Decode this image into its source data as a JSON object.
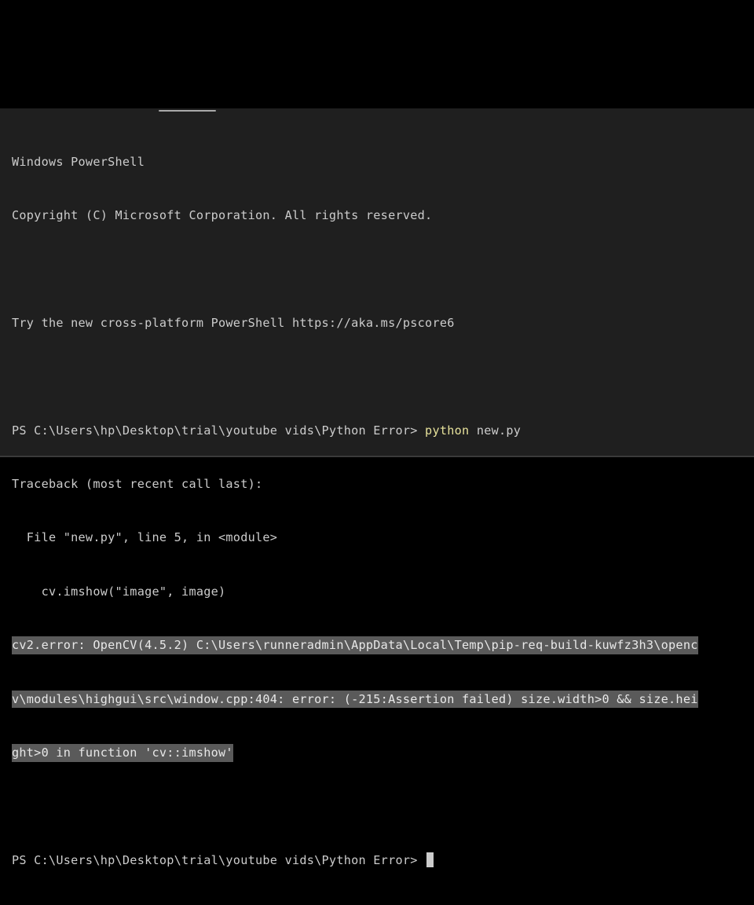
{
  "terminal": {
    "app": "Windows PowerShell",
    "lines": {
      "banner_title": "Windows PowerShell",
      "copyright": "Copyright (C) Microsoft Corporation. All rights reserved.",
      "try_new": "Try the new cross-platform PowerShell https://aka.ms/pscore6",
      "prompt1": "PS C:\\Users\\hp\\Desktop\\trial\\youtube vids\\Python Error> ",
      "command_exe": "python",
      "command_args": " new.py",
      "traceback": "Traceback (most recent call last):",
      "file_line": "  File \"new.py\", line 5, in <module>",
      "code_line": "    cv.imshow(\"image\", image)",
      "error1": "cv2.error: OpenCV(4.5.2) C:\\Users\\runneradmin\\AppData\\Local\\Temp\\pip-req-build-kuwfz3h3\\openc",
      "error2": "v\\modules\\highgui\\src\\window.cpp:404: error: (-215:Assertion failed) size.width>0 && size.hei",
      "error3": "ght>0 in function 'cv::imshow'",
      "prompt2": "PS C:\\Users\\hp\\Desktop\\trial\\youtube vids\\Python Error> "
    },
    "colors": {
      "background": "#1f1f1f",
      "text": "#cccccc",
      "command": "#e5e09a",
      "selection": "#5a5a5a"
    }
  }
}
